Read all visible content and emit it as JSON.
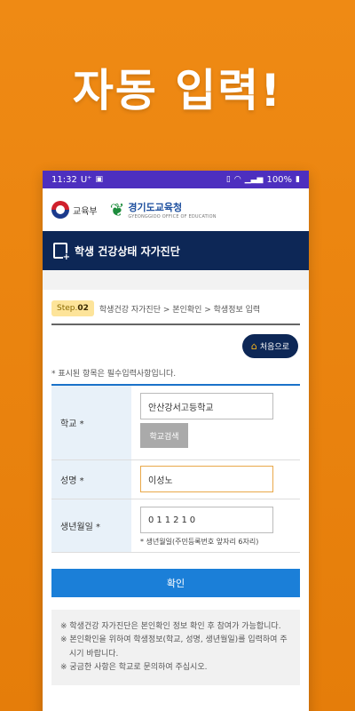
{
  "headline": "자동 입력!",
  "status_bar": {
    "time": "11:32",
    "carrier": "U⁺",
    "battery": "100%"
  },
  "logos": {
    "moe_label": "교육부",
    "gyeonggi_title": "경기도교육청",
    "gyeonggi_sub": "GYEONGGIDO OFFICE OF EDUCATION"
  },
  "title": "학생 건강상태 자가진단",
  "steps": {
    "badge_prefix": "Step.",
    "badge_num": "02",
    "path": "학생건강 자가진단 > 본인확인 > 학생정보 입력"
  },
  "home_button": "처음으로",
  "required_note": "* 표시된 항목은 필수입력사항입니다.",
  "form": {
    "school_label": "학교 *",
    "school_value": "안산강서고등학교",
    "school_search_button": "학교검색",
    "name_label": "성명 *",
    "name_value": "이성노",
    "birth_label": "생년월일 *",
    "birth_value": "011210",
    "birth_hint": "* 생년월일(주민등록번호 앞자리 6자리)"
  },
  "confirm_button": "확인",
  "notices": [
    "※ 학생건강 자가진단은 본인확인 정보 확인 후 참여가 가능합니다.",
    "※ 본인확인을 위하여 학생정보(학교, 성명, 생년월일)를 입력하여 주시기 바랍니다.",
    "※ 궁금한 사항은 학교로 문의하여 주십시오."
  ]
}
